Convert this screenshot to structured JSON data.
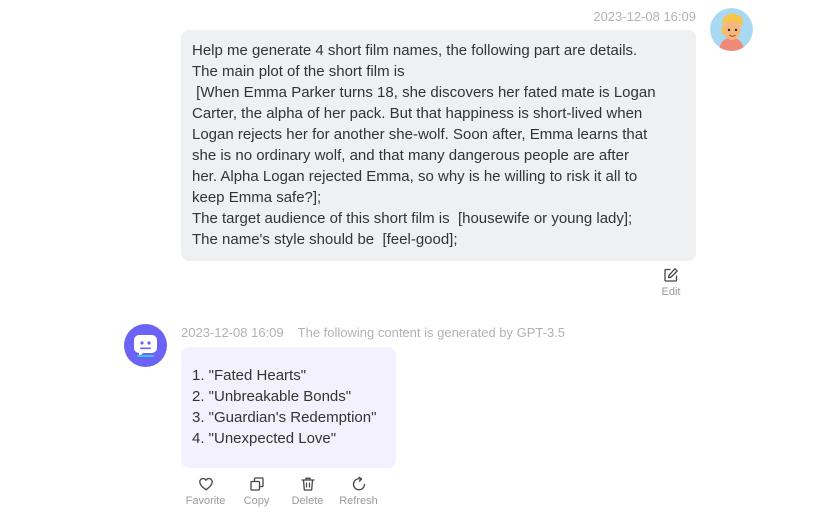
{
  "user_message": {
    "timestamp": "2023-12-08 16:09",
    "lines": [
      "Help me generate 4 short film names, the following part are details.",
      "The main plot of the short film is",
      " [When Emma Parker turns 18, she discovers her fated mate is Logan",
      "Carter, the alpha of her pack. But that happiness is short-lived when",
      "Logan rejects her for another she-wolf. Soon after, Emma learns that",
      "she is no ordinary wolf, and that many dangerous people are after",
      "her. Alpha Logan rejected Emma, so why is he willing to risk it all to",
      "keep Emma safe?];",
      "The target audience of this short film is  [housewife or young lady];",
      "The name's style should be  [feel-good];"
    ],
    "edit_label": "Edit"
  },
  "bot_message": {
    "timestamp": "2023-12-08 16:09",
    "generated_note": "The following content is generated by GPT-3.5",
    "lines": [
      "1. \"Fated Hearts\"",
      "2. \"Unbreakable Bonds\"",
      "3. \"Guardian's Redemption\"",
      "4. \"Unexpected Love\""
    ],
    "actions": {
      "favorite": "Favorite",
      "copy": "Copy",
      "delete": "Delete",
      "refresh": "Refresh"
    }
  },
  "colors": {
    "user_bubble": "#eff0f2",
    "bot_bubble": "#f3f1fd",
    "bot_avatar": "#6b63f5",
    "meta_text": "#b2b2b2"
  },
  "icons": [
    "user-avatar-icon",
    "bot-avatar-icon",
    "edit-icon",
    "heart-icon",
    "copy-icon",
    "trash-icon",
    "refresh-icon"
  ]
}
